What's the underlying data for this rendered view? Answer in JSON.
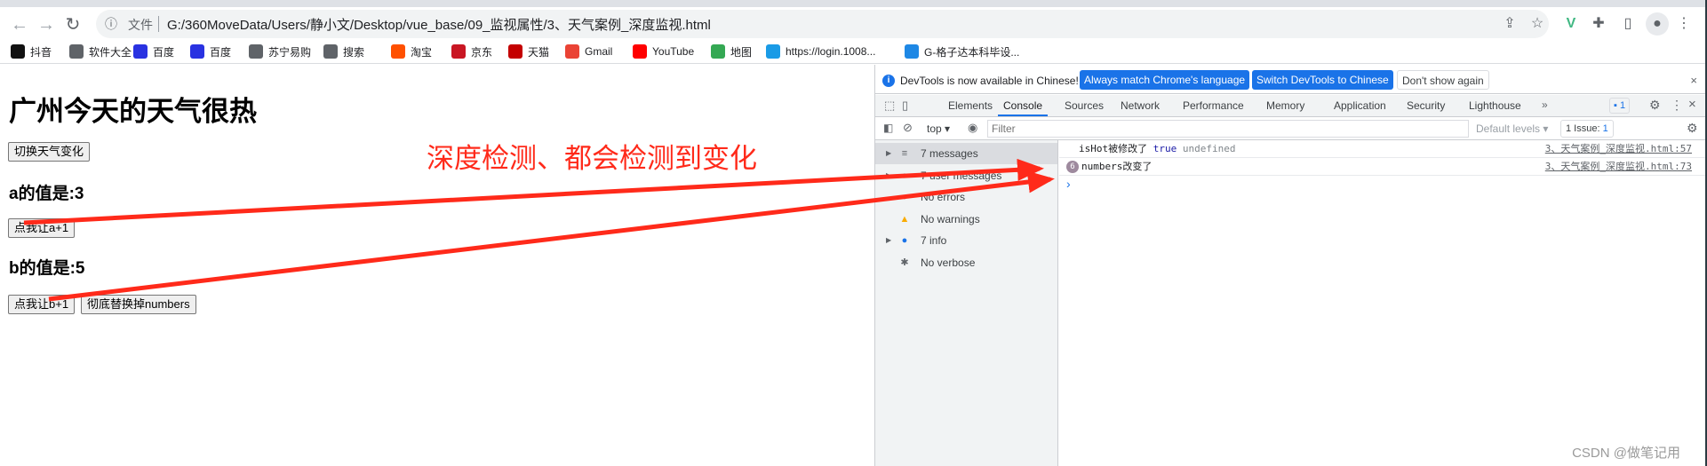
{
  "browser": {
    "address": {
      "security_label": "文件",
      "url": "G:/360MoveData/Users/静小文/Desktop/vue_base/09_监视属性/3、天气案例_深度监视.html"
    },
    "bookmarks": [
      {
        "label": "抖音",
        "icon": "douyin-icon",
        "color": "#111111"
      },
      {
        "label": "软件大全",
        "icon": "globe-icon",
        "color": "#5f6368"
      },
      {
        "label": "百度",
        "icon": "baidu-paw-icon",
        "color": "#2932e1"
      },
      {
        "label": "百度",
        "icon": "baidu-paw-icon",
        "color": "#2932e1"
      },
      {
        "label": "苏宁易购",
        "icon": "globe-icon",
        "color": "#5f6368"
      },
      {
        "label": "搜索",
        "icon": "globe-icon",
        "color": "#5f6368"
      },
      {
        "label": "淘宝",
        "icon": "taobao-icon",
        "color": "#ff5000"
      },
      {
        "label": "京东",
        "icon": "jd-icon",
        "color": "#c91623"
      },
      {
        "label": "天猫",
        "icon": "tmall-icon",
        "color": "#c40000"
      },
      {
        "label": "Gmail",
        "icon": "gmail-icon",
        "color": "#ea4335"
      },
      {
        "label": "YouTube",
        "icon": "youtube-icon",
        "color": "#ff0000"
      },
      {
        "label": "地图",
        "icon": "maps-icon",
        "color": "#34a853"
      },
      {
        "label": "https://login.1008...",
        "icon": "china-mobile-icon",
        "color": "#1a9be6"
      },
      {
        "label": "G-格子达本科毕设...",
        "icon": "gezida-icon",
        "color": "#1e88e5"
      }
    ]
  },
  "page": {
    "title": "广州今天的天气很热",
    "toggle_button": "切换天气变化",
    "a_label": "a的值是:3",
    "a_button": "点我让a+1",
    "b_label": "b的值是:5",
    "b_button": "点我让b+1",
    "replace_button": "彻底替换掉numbers",
    "annotation": "深度检测、都会检测到变化"
  },
  "devtools": {
    "banner": {
      "text": "DevTools is now available in Chinese!",
      "match_button": "Always match Chrome's language",
      "switch_button": "Switch DevTools to Chinese",
      "dismiss_button": "Don't show again"
    },
    "tabs": [
      "Elements",
      "Console",
      "Sources",
      "Network",
      "Performance",
      "Memory",
      "Application",
      "Security",
      "Lighthouse"
    ],
    "active_tab": "Console",
    "issues_badge": "1",
    "console_toolbar": {
      "context": "top",
      "filter_placeholder": "Filter",
      "levels": "Default levels",
      "issues": "1 Issue:",
      "issues_count": "1"
    },
    "sidebar": [
      {
        "label": "7 messages",
        "icon": "list-icon",
        "expandable": true,
        "selected": true
      },
      {
        "label": "7 user messages",
        "icon": "user-icon",
        "expandable": true
      },
      {
        "label": "No errors",
        "icon": "error-icon"
      },
      {
        "label": "No warnings",
        "icon": "warning-icon"
      },
      {
        "label": "7 info",
        "icon": "info-icon",
        "expandable": true
      },
      {
        "label": "No verbose",
        "icon": "bug-icon"
      }
    ],
    "messages": [
      {
        "text": "isHot被修改了",
        "value1": "true",
        "value2": "undefined",
        "source": "3、天气案例_深度监视.html:57"
      },
      {
        "count": "6",
        "text": "numbers改变了",
        "source": "3、天气案例_深度监视.html:73"
      }
    ],
    "prompt": "›"
  },
  "watermark": "CSDN @做笔记用",
  "colors": {
    "accent": "#1a73e8",
    "annotation": "#ff2a1a"
  }
}
